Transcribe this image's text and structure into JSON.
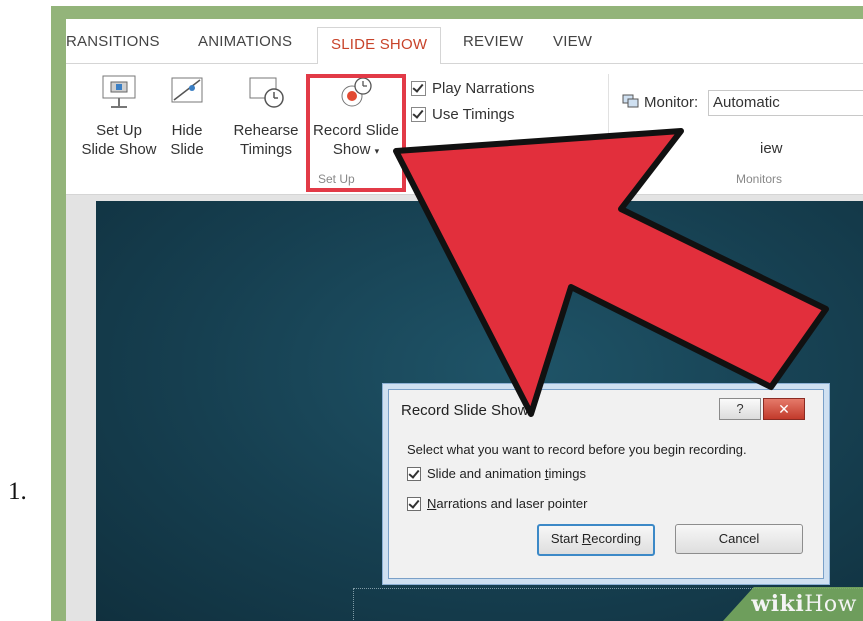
{
  "step": {
    "number": "1."
  },
  "tabs": [
    {
      "label": "RANSITIONS"
    },
    {
      "label": "ANIMATIONS"
    },
    {
      "label": "SLIDE SHOW"
    },
    {
      "label": "REVIEW"
    },
    {
      "label": "VIEW"
    }
  ],
  "ribbon": {
    "setup_show": {
      "line1": "Set Up",
      "line2": "Slide Show"
    },
    "hide_slide": {
      "line1": "Hide",
      "line2": "Slide"
    },
    "rehearse": {
      "line1": "Rehearse",
      "line2": "Timings"
    },
    "record": {
      "line1": "Record Slide",
      "line2": "Show"
    },
    "play_narrations": "Play Narrations",
    "use_timings": "Use Timings",
    "setup_group_label": "Set Up",
    "monitor_label": "Monitor:",
    "monitor_value": "Automatic",
    "presenter_view_partial": "iew",
    "monitors_group_label": "Monitors"
  },
  "dialog": {
    "title": "Record Slide Show",
    "help": "?",
    "close": "✕",
    "instruction": "Select what you want to record before you begin recording.",
    "option1_pre": "Slide and animation ",
    "option1_u": "t",
    "option1_post": "imings",
    "option2_u": "N",
    "option2_post": "arrations and laser pointer",
    "start_pre": "Start ",
    "start_u": "R",
    "start_post": "ecording",
    "cancel": "Cancel"
  },
  "watermark": {
    "bold": "wiki",
    "thin": "How"
  },
  "colors": {
    "frame_green": "#93b47a",
    "accent_red": "#e23a47",
    "active_tab": "#c8432a",
    "slide_bg": "#163f50"
  },
  "icons": [
    "setup-show-icon",
    "hide-slide-icon",
    "rehearse-timings-icon",
    "record-slide-show-icon",
    "monitor-icon",
    "help-icon",
    "close-icon",
    "red-arrow-icon"
  ]
}
